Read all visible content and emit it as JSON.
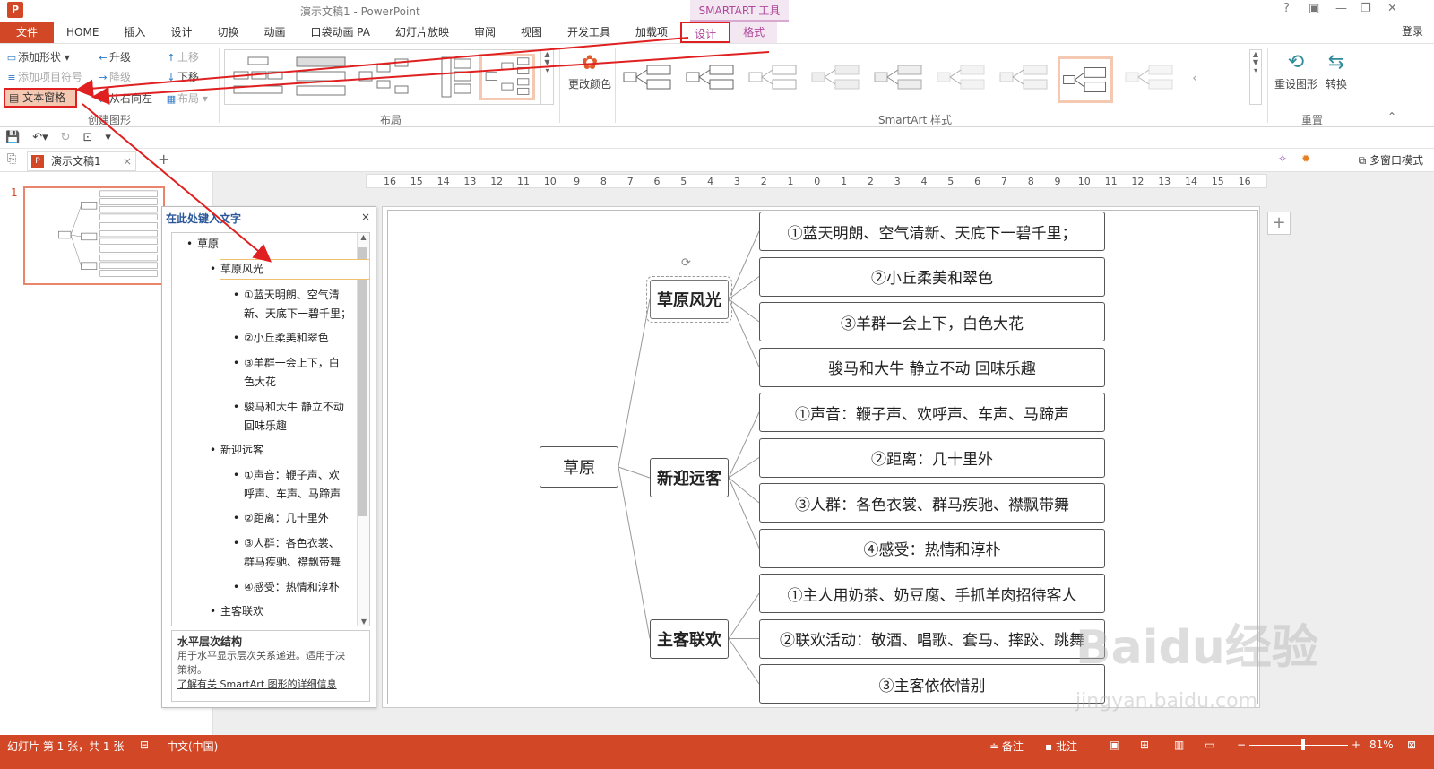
{
  "window": {
    "title": "演示文稿1 - PowerPoint",
    "app_icon": "P",
    "help": "?",
    "login": "登录",
    "contextual_tab": "SMARTART 工具"
  },
  "tabs": [
    "文件",
    "HOME",
    "插入",
    "设计",
    "切换",
    "动画",
    "口袋动画 PA",
    "幻灯片放映",
    "审阅",
    "视图",
    "开发工具",
    "加载项",
    "设计",
    "格式"
  ],
  "ribbon": {
    "create_graphic": {
      "add_shape": "添加形状",
      "add_bullet": "添加项目符号",
      "text_pane": "文本窗格",
      "promote": "升级",
      "demote": "降级",
      "rtl": "从右向左",
      "move_up": "上移",
      "move_down": "下移",
      "layout": "布局",
      "label": "创建图形"
    },
    "layouts_label": "布局",
    "change_color": "更改颜色",
    "styles_label": "SmartArt 样式",
    "reset_graphic": "重设图形",
    "convert": "转换",
    "reset_label": "重置"
  },
  "doc": {
    "tab_name": "演示文稿1",
    "multiwin": "多窗口模式",
    "slide_number": "1"
  },
  "ruler": [
    "16",
    "15",
    "14",
    "13",
    "12",
    "11",
    "10",
    "9",
    "8",
    "7",
    "6",
    "5",
    "4",
    "3",
    "2",
    "1",
    "0",
    "1",
    "2",
    "3",
    "4",
    "5",
    "6",
    "7",
    "8",
    "9",
    "10",
    "11",
    "12",
    "13",
    "14",
    "15",
    "16"
  ],
  "smartart": {
    "root": "草原",
    "branches": [
      {
        "label": "草原风光",
        "items": [
          "①蓝天明朗、空气清新、天底下一碧千里；",
          "②小丘柔美和翠色",
          "③羊群一会上下，白色大花",
          "骏马和大牛 静立不动 回味乐趣"
        ]
      },
      {
        "label": "新迎远客",
        "items": [
          "①声音：鞭子声、欢呼声、车声、马蹄声",
          "②距离：几十里外",
          "③人群：各色衣裳、群马疾驰、襟飘带舞",
          "④感受：热情和淳朴"
        ]
      },
      {
        "label": "主客联欢",
        "items": [
          "①主人用奶茶、奶豆腐、手抓羊肉招待客人",
          "②联欢活动：敬酒、唱歌、套马、摔跤、跳舞",
          "③主客依依惜别"
        ]
      }
    ]
  },
  "text_pane": {
    "title": "在此处键入文字",
    "close": "×",
    "lines": [
      {
        "level": 0,
        "text": "草原"
      },
      {
        "level": 1,
        "text": "草原风光"
      },
      {
        "level": 2,
        "text": "①蓝天明朗、空气清"
      },
      {
        "level": 2,
        "text": "新、天底下一碧千里；"
      },
      {
        "level": 2,
        "text": "②小丘柔美和翠色"
      },
      {
        "level": 2,
        "text": "③羊群一会上下，白"
      },
      {
        "level": 2,
        "text": "色大花"
      },
      {
        "level": 2,
        "text": "骏马和大牛 静立不动"
      },
      {
        "level": 2,
        "text": "回味乐趣"
      },
      {
        "level": 1,
        "text": "新迎远客"
      },
      {
        "level": 2,
        "text": "①声音：鞭子声、欢"
      },
      {
        "level": 2,
        "text": "呼声、车声、马蹄声"
      },
      {
        "level": 2,
        "text": "②距离：几十里外"
      },
      {
        "level": 2,
        "text": "③人群：各色衣裳、"
      },
      {
        "level": 2,
        "text": "群马疾驰、襟飘带舞"
      },
      {
        "level": 2,
        "text": "④感受：热情和淳朴"
      },
      {
        "level": 1,
        "text": "主客联欢"
      }
    ],
    "desc_title": "水平层次结构",
    "desc_line1": "用于水平显示层次关系递进。适用于决",
    "desc_line2": "策树。",
    "desc_link": "了解有关 SmartArt 图形的详细信息"
  },
  "status": {
    "slide_info": "幻灯片 第 1 张，共 1 张",
    "language": "中文(中国)",
    "notes": "备注",
    "comments": "批注",
    "zoom": "81%"
  },
  "watermark": {
    "main": "Baidu经验",
    "sub": "jingyan.baidu.com"
  },
  "colors": {
    "accent": "#d24726",
    "smartart_tab": "#b0489a",
    "highlight": "#e02020"
  }
}
